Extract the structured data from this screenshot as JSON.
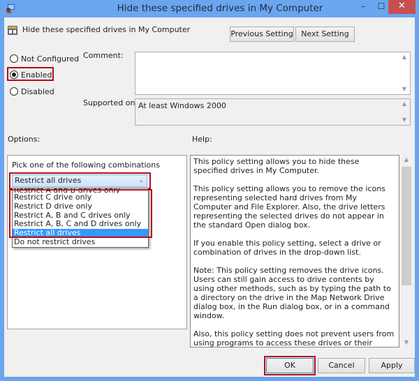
{
  "window": {
    "title": "Hide these specified drives in My Computer",
    "controls": {
      "minimize": "–",
      "maximize": "☐",
      "close": "✕"
    }
  },
  "header": {
    "policy_name": "Hide these specified drives in My Computer",
    "previous_setting_label": "Previous Setting",
    "next_setting_label": "Next Setting"
  },
  "state": {
    "options": [
      {
        "label": "Not Configured",
        "checked": false
      },
      {
        "label": "Enabled",
        "checked": true
      },
      {
        "label": "Disabled",
        "checked": false
      }
    ]
  },
  "comment": {
    "label": "Comment:",
    "value": ""
  },
  "supported_on": {
    "label": "Supported on:",
    "value": "At least Windows 2000"
  },
  "options_section": {
    "label": "Options:",
    "pick_label": "Pick one of the following combinations",
    "selected": "Restrict all drives",
    "dropdown_items": [
      "Restrict A and B drives only",
      "Restrict C drive only",
      "Restrict D drive only",
      "Restrict A, B and C drives only",
      "Restrict A, B, C and D drives only",
      "Restrict all drives",
      "Do not restrict drives"
    ],
    "dropdown_selected_index": 5
  },
  "help_section": {
    "label": "Help:",
    "paragraphs": [
      "This policy setting allows you to hide these specified drives in My Computer.",
      "This policy setting allows you to remove the icons representing selected hard drives from My Computer and File Explorer. Also, the drive letters representing the selected drives do not appear in the standard Open dialog box.",
      "If you enable this policy setting, select a drive or combination of drives in the drop-down list.",
      "Note: This policy setting removes the drive icons. Users can still gain access to drive contents by using other methods, such as by typing the path to a directory on the drive in the Map Network Drive dialog box, in the Run dialog box, or in a command window.",
      "Also, this policy setting does not prevent users from using programs to access these drives or their contents. And, it does not prevent users from using the Disk Management snap-in to view and change drive characteristics."
    ]
  },
  "footer": {
    "ok_label": "OK",
    "cancel_label": "Cancel",
    "apply_label": "Apply"
  },
  "colors": {
    "highlight_box": "#b30f17",
    "titlebar": "#6aa5ef",
    "close_button": "#c7504e",
    "selection": "#3399ff"
  }
}
